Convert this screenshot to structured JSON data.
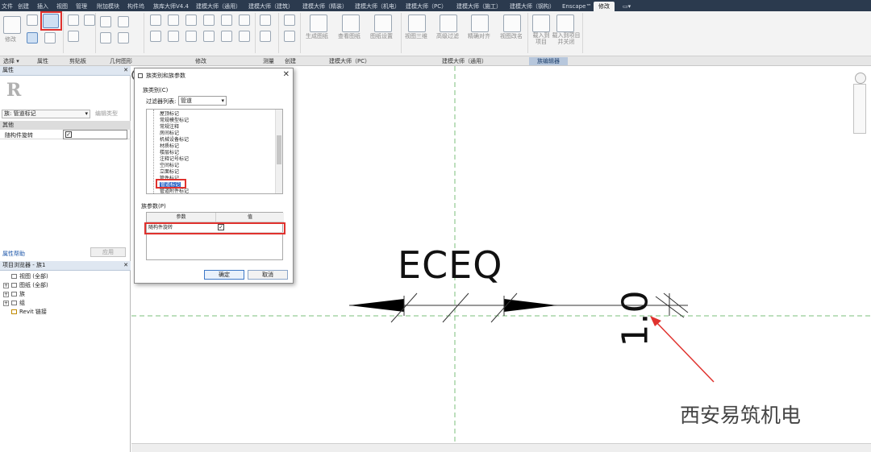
{
  "ribbon": {
    "tabs": [
      "文件",
      "创建",
      "插入",
      "视图",
      "管理",
      "附加模块",
      "构件坞",
      "族库大师V4.4",
      "建模大师（通用）",
      "建模大师（建筑）",
      "建模大师（精装）",
      "建模大师（机电）",
      "建模大师（PC）",
      "建模大师（施工）",
      "建模大师（钢构）",
      "Enscape™",
      "修改",
      "▭▾"
    ],
    "active_tab": "修改",
    "button_labels": {
      "modify": "修改",
      "generate": "生成图纸",
      "view_drawing": "查看图纸",
      "drawing_settings": "图纸设置",
      "gen_3d": "视图三维",
      "advanced_filter": "高级过滤",
      "align": "精确对齐",
      "view_name": "视图改名",
      "load_project": "载入到项目",
      "load_close": "载入到项目并关闭"
    },
    "panels": [
      "选择 ▾",
      "属性",
      "剪贴板",
      "几何图形",
      "修改",
      "测量",
      "创建",
      "建模大师（PC）",
      "建模大师（通用）",
      "族编辑器"
    ],
    "highlight_panel": "族编辑器"
  },
  "properties": {
    "title": "属性",
    "close": "✕",
    "logo": "R",
    "type_selector": "族: 管道标记",
    "edit_type": "编辑类型",
    "group": "其他",
    "param_name": "随构件旋转",
    "param_checked": true,
    "help_link": "属性帮助",
    "apply": "应用"
  },
  "browser": {
    "title": "项目浏览器 - 族1",
    "close": "✕",
    "items": [
      {
        "expand": "",
        "label": "视图 (全部)"
      },
      {
        "expand": "+",
        "label": "图纸 (全部)"
      },
      {
        "expand": "+",
        "label": "族"
      },
      {
        "expand": "+",
        "label": "组"
      },
      {
        "expand": "",
        "label": "Revit 链接"
      }
    ]
  },
  "dialog": {
    "title": "族类别和族参数",
    "close": "✕",
    "category_label": "族类别(C)",
    "filter_label": "过滤器列表:",
    "filter_value": "管道",
    "categories": [
      "屋顶标记",
      "常规模型标记",
      "常规注释",
      "房间标记",
      "机械设备标记",
      "材质标记",
      "楼层标记",
      "注释记号标记",
      "空间标记",
      "立面标记",
      "管件标记",
      "管道标记",
      "管道附件标记"
    ],
    "selected_category": "管道标记",
    "param_section": "族参数(P)",
    "col_param": "参数",
    "col_value": "值",
    "row_param": "随构件旋转",
    "row_checked": true,
    "ok": "确定",
    "cancel": "取消"
  },
  "canvas": {
    "label_text": "ECEQ",
    "value_text": "1.0",
    "watermark": "西安易筑机电"
  },
  "colors": {
    "highlight": "#e0322e",
    "selection": "#2b66c7",
    "tabbar": "#2b3a4e"
  }
}
